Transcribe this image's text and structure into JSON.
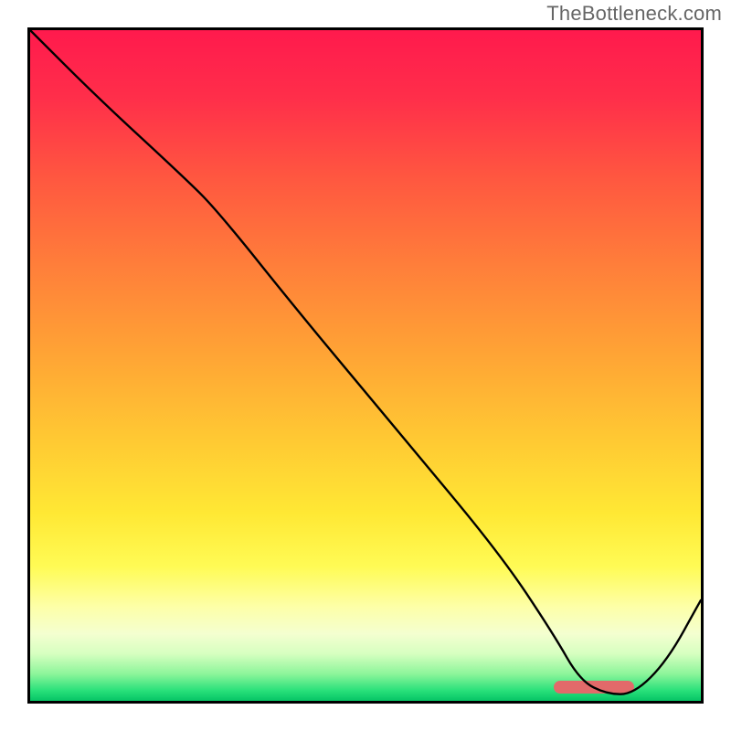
{
  "watermark": "TheBottleneck.com",
  "chart_data": {
    "type": "line",
    "title": "",
    "xlabel": "",
    "ylabel": "",
    "xlim": [
      0,
      100
    ],
    "ylim": [
      0,
      100
    ],
    "grid": false,
    "legend": false,
    "series": [
      {
        "name": "bottleneck-curve",
        "x": [
          0,
          10,
          23,
          28,
          40,
          55,
          70,
          78,
          82,
          86,
          90,
          95,
          100
        ],
        "y": [
          100,
          90,
          78,
          73,
          58,
          40,
          22,
          10,
          3,
          1,
          1,
          6,
          15
        ]
      }
    ],
    "optimum_range_x": [
      78,
      90
    ],
    "gradient_stops": [
      {
        "pos": 0,
        "color": "#ff1a4d"
      },
      {
        "pos": 0.1,
        "color": "#ff2e4a"
      },
      {
        "pos": 0.22,
        "color": "#ff5740"
      },
      {
        "pos": 0.35,
        "color": "#ff7e3a"
      },
      {
        "pos": 0.48,
        "color": "#ffa335"
      },
      {
        "pos": 0.6,
        "color": "#ffc633"
      },
      {
        "pos": 0.72,
        "color": "#ffe834"
      },
      {
        "pos": 0.8,
        "color": "#fffb55"
      },
      {
        "pos": 0.86,
        "color": "#fdffa8"
      },
      {
        "pos": 0.9,
        "color": "#f4ffd0"
      },
      {
        "pos": 0.93,
        "color": "#d6ffc0"
      },
      {
        "pos": 0.96,
        "color": "#8cf59a"
      },
      {
        "pos": 0.985,
        "color": "#28e07a"
      },
      {
        "pos": 1.0,
        "color": "#06c465"
      }
    ]
  }
}
